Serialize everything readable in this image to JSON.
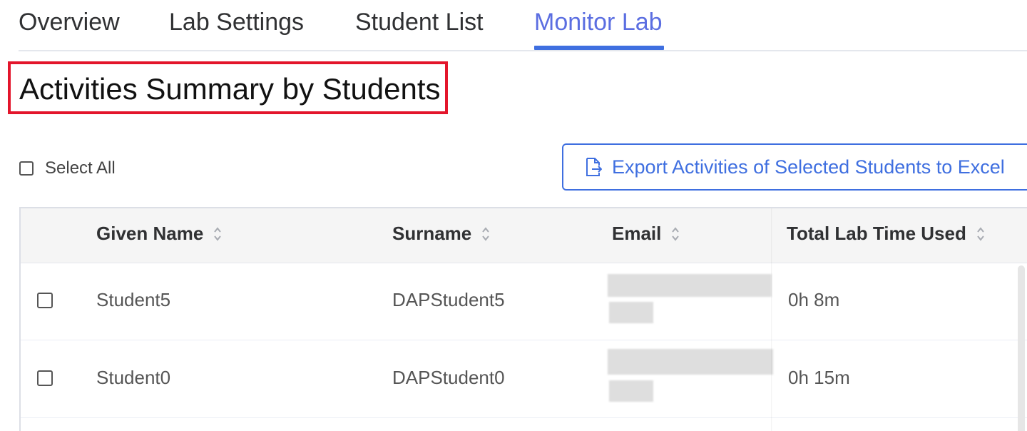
{
  "tabs": [
    {
      "label": "Overview"
    },
    {
      "label": "Lab Settings"
    },
    {
      "label": "Student List"
    },
    {
      "label": "Monitor Lab",
      "active": true
    }
  ],
  "title": "Activities Summary by Students",
  "select_all_label": "Select All",
  "export_button_label": "Export Activities of Selected Students to Excel",
  "table": {
    "headers": [
      "Given Name",
      "Surname",
      "Email",
      "Total Lab Time Used"
    ],
    "rows": [
      {
        "given_name": "Student5",
        "surname": "DAPStudent5",
        "lab_time": "0h 8m"
      },
      {
        "given_name": "Student0",
        "surname": "DAPStudent0",
        "lab_time": "0h 15m"
      }
    ]
  },
  "colors": {
    "accent": "#3f6fe0",
    "active_tab": "#5b6ee1",
    "highlight_border": "#e3152b"
  },
  "icons": {
    "export": "export-file-icon",
    "sort": "sort-icon"
  }
}
